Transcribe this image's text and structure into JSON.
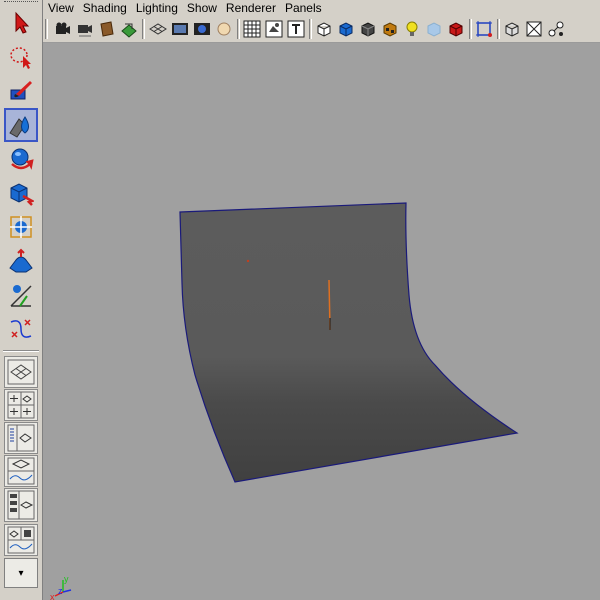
{
  "menu": {
    "items": [
      "View",
      "Shading",
      "Lighting",
      "Show",
      "Renderer",
      "Panels"
    ]
  },
  "toolbox": {
    "tools": [
      "select-arrow-icon",
      "lasso-select-icon",
      "paint-select-icon",
      "move-tool-icon",
      "rotate-tool-icon",
      "scale-tool-icon",
      "universal-manipulator-icon",
      "soft-modification-icon",
      "show-manipulator-icon",
      "last-tool-used-icon"
    ],
    "active_tool": "move-tool-icon",
    "layouts": [
      "single-perspective-layout-icon",
      "four-view-layout-icon",
      "outliner-perspective-layout-icon",
      "perspective-graph-layout-icon",
      "hypershade-perspective-layout-icon",
      "perspective-graph-hypershade-layout-icon"
    ]
  },
  "iconbar": {
    "icons": [
      "select-camera-icon",
      "camera-attributes-icon",
      "bookmarks-icon",
      "image-plane-icon",
      "grid-icon",
      "film-gate-icon",
      "resolution-gate-icon",
      "gate-mask-icon",
      "field-chart-icon",
      "safe-action-icon",
      "safe-title-icon",
      "wireframe-icon",
      "smooth-shade-icon",
      "flat-shade-icon",
      "textured-icon",
      "use-all-lights-icon",
      "shadows-icon",
      "xray-icon",
      "backface-culling-icon",
      "isolate-select-icon",
      "xray-joints-icon",
      "hypershade-icon"
    ]
  },
  "viewport": {
    "background": "#a0a0a0",
    "surface_color": "#5a5a5a",
    "axis": {
      "x_label": "x",
      "y_label": "y",
      "z_label": "z",
      "x_color": "#e02020",
      "y_color": "#20c020",
      "z_color": "#2030e0"
    }
  }
}
